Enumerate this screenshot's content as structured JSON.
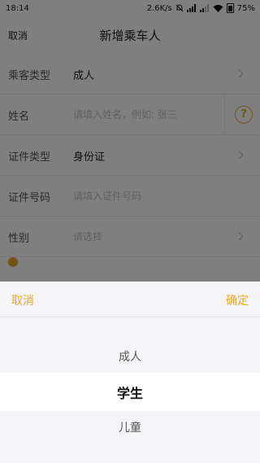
{
  "status_bar": {
    "time": "18:14",
    "network_speed": "2.6K/s",
    "battery": "75%",
    "icons": [
      "alarm-off-icon",
      "signal-icon",
      "signal-icon",
      "wifi-icon",
      "battery-icon"
    ]
  },
  "nav": {
    "cancel_label": "取消",
    "title": "新增乘车人"
  },
  "form": {
    "passenger_type": {
      "label": "乘客类型",
      "value": "成人"
    },
    "name": {
      "label": "姓名",
      "placeholder": "请填入姓名，例如: 张三"
    },
    "id_type": {
      "label": "证件类型",
      "value": "身份证"
    },
    "id_number": {
      "label": "证件号码",
      "placeholder": "请填入证件号码"
    },
    "gender": {
      "label": "性别",
      "placeholder": "请选择"
    }
  },
  "picker": {
    "cancel_label": "取消",
    "confirm_label": "确定",
    "options": [
      "成人",
      "学生",
      "儿童"
    ],
    "selected": "学生",
    "accent_color": "#e9a927"
  }
}
